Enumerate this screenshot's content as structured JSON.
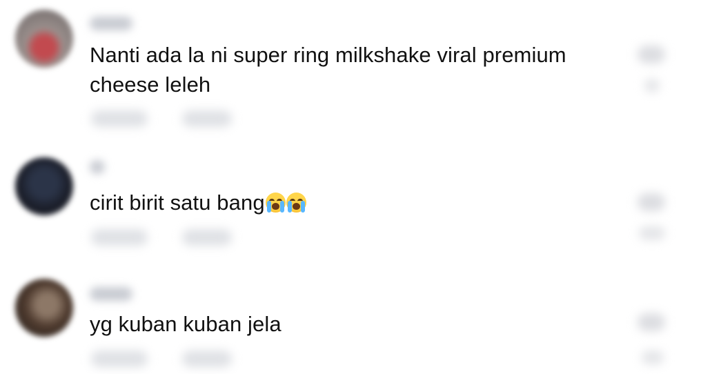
{
  "comments": [
    {
      "text": "Nanti ada la ni super ring milkshake viral premium cheese leleh",
      "emojis": []
    },
    {
      "text": "cirit birit satu bang",
      "emojis": [
        "loudly-crying-face",
        "loudly-crying-face"
      ]
    },
    {
      "text": "yg kuban kuban jela",
      "emojis": []
    }
  ],
  "colors": {
    "comment_text": "#111111",
    "blurred_meta": "#dfe1e5",
    "background": "#ffffff"
  }
}
